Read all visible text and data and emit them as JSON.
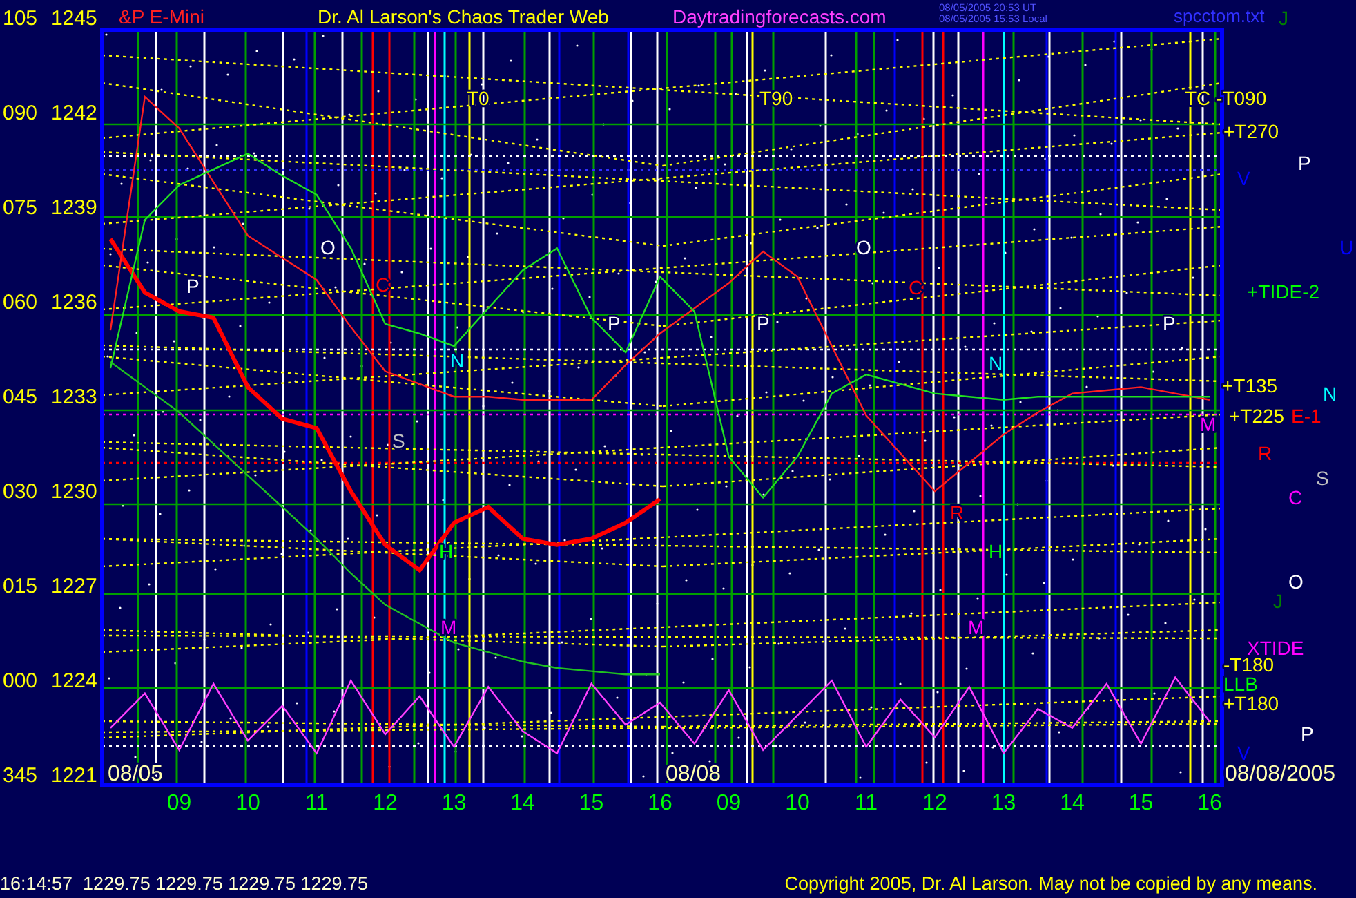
{
  "header": {
    "instrument": "&P E-Mini",
    "title": "Dr. Al Larson's Chaos Trader Web",
    "site": "Daytradingforecasts.com",
    "timestamps": [
      "08/05/2005 20:53 UT",
      "08/05/2005 15:53 Local"
    ],
    "file": "spcctom.txt"
  },
  "chart": {
    "degree_labels": [
      "105",
      "090",
      "075",
      "060",
      "045",
      "030",
      "015",
      "000",
      "345"
    ],
    "date_labels": [
      "08/05",
      "08/08",
      "08/08/2005"
    ],
    "labels": [
      {
        "text": "J",
        "color": "#008000"
      },
      {
        "text": "T0",
        "color": "#ffff00"
      },
      {
        "text": "T90",
        "color": "#ffff00"
      },
      {
        "text": "TC -T090",
        "color": "#ffff00"
      },
      {
        "text": "+T270",
        "color": "#ffff00"
      },
      {
        "text": "P",
        "color": "#ffffff"
      },
      {
        "text": "V",
        "color": "#0000ff"
      },
      {
        "text": "O",
        "color": "#ffffff"
      },
      {
        "text": "O",
        "color": "#ffffff"
      },
      {
        "text": "U",
        "color": "#0000ff"
      },
      {
        "text": "C",
        "color": "#ff0000"
      },
      {
        "text": "C",
        "color": "#ff0000"
      },
      {
        "text": "+TIDE-2",
        "color": "#00ff00"
      },
      {
        "text": "P",
        "color": "#ffffff"
      },
      {
        "text": "P",
        "color": "#ffffff"
      },
      {
        "text": "P",
        "color": "#ffffff"
      },
      {
        "text": "P",
        "color": "#ffffff"
      },
      {
        "text": "N",
        "color": "#00ffff"
      },
      {
        "text": "N",
        "color": "#00ffff"
      },
      {
        "text": "+T135",
        "color": "#ffff00"
      },
      {
        "text": "N",
        "color": "#00ffff"
      },
      {
        "text": "M",
        "color": "#ff00ff"
      },
      {
        "text": "+T225",
        "color": "#ffff00"
      },
      {
        "text": "E-1",
        "color": "#ff0000"
      },
      {
        "text": "S",
        "color": "#c0c0c0"
      },
      {
        "text": "R",
        "color": "#ff0000"
      },
      {
        "text": "S",
        "color": "#c0c0c0"
      },
      {
        "text": "C",
        "color": "#ff00ff"
      },
      {
        "text": "R",
        "color": "#ff0000"
      },
      {
        "text": "H",
        "color": "#00ff00"
      },
      {
        "text": "H",
        "color": "#00ff00"
      },
      {
        "text": "O",
        "color": "#ffffff"
      },
      {
        "text": "J",
        "color": "#008000"
      },
      {
        "text": "M",
        "color": "#ff00ff"
      },
      {
        "text": "M",
        "color": "#ff00ff"
      },
      {
        "text": "XTIDE",
        "color": "#ff00ff"
      },
      {
        "text": "-T180",
        "color": "#ffff00"
      },
      {
        "text": "LLB",
        "color": "#00ff00"
      },
      {
        "text": "+T180",
        "color": "#ffff00"
      },
      {
        "text": "P",
        "color": "#ffffff"
      },
      {
        "text": "V",
        "color": "#0000ff"
      }
    ],
    "chart_data": {
      "type": "line",
      "categories": [
        null,
        null,
        "09",
        null,
        "10",
        null,
        "11",
        null,
        "12",
        null,
        "13",
        null,
        "14",
        null,
        "15",
        null,
        "16",
        null,
        "09",
        null,
        "10",
        null,
        "11",
        null,
        "12",
        null,
        "13",
        null,
        "14",
        null,
        "15",
        null,
        "16"
      ],
      "series": [
        {
          "color": "#ff0000",
          "values": [
            1238,
            1236.3,
            1235.7,
            1235.5,
            1233.3,
            1232.3,
            1232,
            1230,
            1228.3,
            1227.5,
            1229,
            1229.5,
            1228.5,
            1228.3,
            1228.5,
            1229,
            1229.75,
            null,
            null,
            null,
            null,
            null,
            null,
            null,
            null,
            null,
            null,
            null,
            null,
            null,
            null,
            null,
            null
          ]
        },
        {
          "color": "#ff2020",
          "values": [
            1235.1,
            1242.5,
            1241.5,
            1239.8,
            1238.1,
            1237.4,
            1236.7,
            1235.2,
            1233.8,
            1233.4,
            1233,
            1233,
            1232.9,
            1232.9,
            1232.9,
            1234,
            1235,
            1235.8,
            1236.6,
            1237.6,
            1236.8,
            1234.6,
            1232.4,
            1231.2,
            1230,
            1230.9,
            1231.8,
            1232.5,
            1233.1,
            1233.2,
            1233.3,
            1233.1,
            1232.9
          ]
        },
        {
          "color": "#20e020",
          "values": [
            1233.9,
            1238.6,
            1239.7,
            1240.2,
            1240.7,
            1240,
            1239.4,
            1237.7,
            1235.3,
            1235,
            1234.6,
            1235.8,
            1237,
            1237.7,
            1235.5,
            1234.4,
            1236.8,
            1235.7,
            1231.1,
            1229.8,
            1231.1,
            1233.1,
            1233.7,
            1233.4,
            1233.1,
            1233,
            1232.9,
            1233,
            1233,
            1233,
            1233,
            1233,
            1233
          ]
        },
        {
          "color": "#20c020",
          "values": [
            1234.1,
            1233.3,
            1232.5,
            1231.5,
            1230.5,
            1229.5,
            1228.5,
            1227.4,
            1226.4,
            1225.8,
            1225.2,
            1224.9,
            1224.6,
            1224.4,
            1224.3,
            1224.2,
            1224.2,
            null,
            null,
            null,
            null,
            null,
            null,
            null,
            null,
            null,
            null,
            null,
            null,
            null,
            null,
            null,
            null
          ]
        },
        {
          "color": "#ff40ff",
          "values": [
            1222.5,
            1223.6,
            1221.8,
            1223.9,
            1222.1,
            1223.2,
            1221.7,
            1224,
            1222.3,
            1223.5,
            1221.9,
            1223.8,
            1222.4,
            1221.7,
            1223.9,
            1222.6,
            1223.3,
            1222,
            1223.7,
            1221.8,
            1222.9,
            1224,
            1221.9,
            1223.4,
            1222.2,
            1223.8,
            1221.7,
            1223.1,
            1222.5,
            1223.9,
            1222,
            1224.1,
            1222.7
          ]
        }
      ],
      "ylim": [
        1220.7,
        1245
      ],
      "grid": true,
      "yticks": [
        {
          "value": 1245,
          "label": "1245"
        },
        {
          "value": 1242,
          "label": "1242"
        },
        {
          "value": 1239,
          "label": "1239"
        },
        {
          "value": 1236,
          "label": "1236"
        },
        {
          "value": 1233,
          "label": "1233"
        },
        {
          "value": 1230,
          "label": "1230"
        },
        {
          "value": 1227,
          "label": "1227"
        },
        {
          "value": 1224,
          "label": "1224"
        },
        {
          "value": 1221,
          "label": "1221"
        }
      ]
    }
  },
  "status_bar": {
    "quote": "16:14:57  1229.75 1229.75 1229.75 1229.75",
    "copyright": "Copyright 2005, Dr. Al Larson. May not be copied by any means."
  }
}
